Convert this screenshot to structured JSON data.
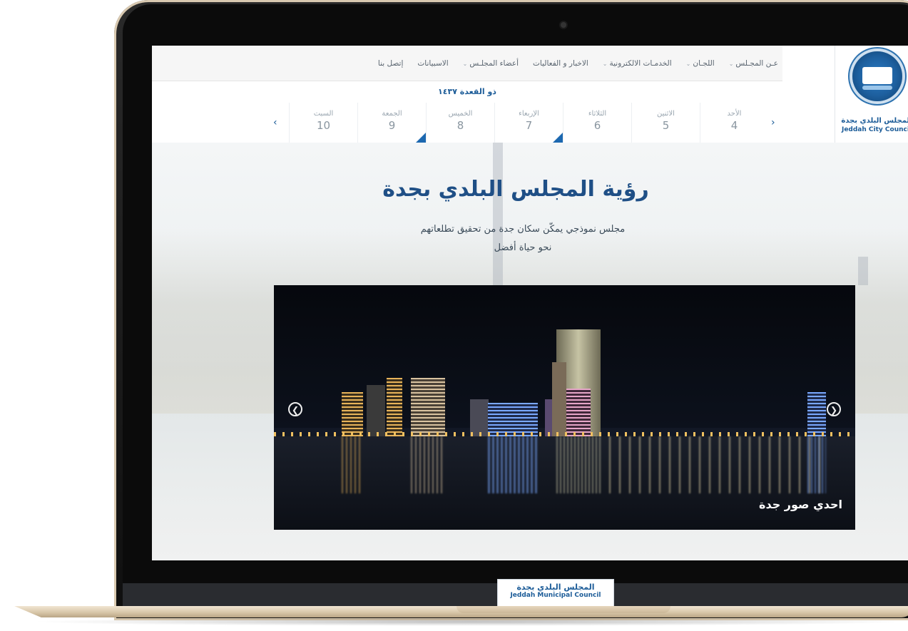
{
  "header": {
    "logo_ar": "المجلس البلدي بجدة",
    "logo_en": "Jeddah City Council",
    "nav": [
      {
        "label": "عـن المجـلس",
        "caret": "⌄"
      },
      {
        "label": "اللجـان",
        "caret": "⌄"
      },
      {
        "label": "الخدمـات الالكترونية",
        "caret": "⌄"
      },
      {
        "label": "الاخبار و الفعاليات",
        "caret": ""
      },
      {
        "label": "أعضاء المجلـس",
        "caret": "⌄"
      },
      {
        "label": "الاسبيانات",
        "caret": ""
      },
      {
        "label": "إتصل بنا",
        "caret": ""
      }
    ]
  },
  "calendar": {
    "hijri_month": "ذو القعدة ١٤٣٧",
    "prev": "‹",
    "next": "›",
    "days": [
      {
        "name": "الأحد",
        "date": "4",
        "flag": false
      },
      {
        "name": "الاثنين",
        "date": "5",
        "flag": false
      },
      {
        "name": "الثلاثاء",
        "date": "6",
        "flag": false
      },
      {
        "name": "الإربعاء",
        "date": "7",
        "flag": true
      },
      {
        "name": "الخميس",
        "date": "8",
        "flag": false
      },
      {
        "name": "الجمعة",
        "date": "9",
        "flag": true
      },
      {
        "name": "السبت",
        "date": "10",
        "flag": false
      }
    ]
  },
  "hero": {
    "title": "رؤية المجلس البلدي بجدة",
    "subtitle_line1": "مجلس نموذجي يمكّن سكان جدة من تحقيق تطلعاتهم",
    "subtitle_line2": "نحو حياة أفضل"
  },
  "slider": {
    "caption": "احدي صور جدة",
    "prev_icon": "❮",
    "next_icon": "❯"
  },
  "footer": {
    "name_ar": "المجلس البلدي بجدة",
    "name_en": "Jeddah Municipal Council"
  },
  "colors": {
    "brand_blue": "#1c5c98",
    "accent_blue": "#1c68b0"
  }
}
